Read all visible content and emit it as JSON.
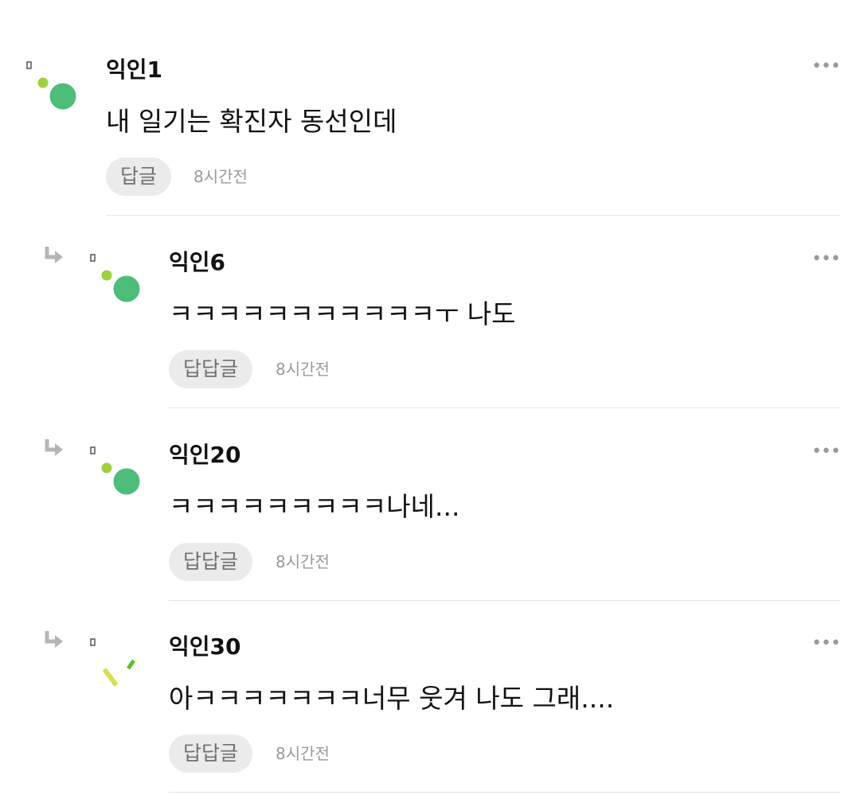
{
  "colors": {
    "avatar_green": "#4dbd7a",
    "avatar_lime": "#9cd23a",
    "avatar_yellow": "#d7df4d",
    "reply_button_bg": "#ebebeb",
    "meta_gray": "#9a9a9a"
  },
  "comments": [
    {
      "author": "익인1",
      "text": "내 일기는 확진자 동선인데",
      "reply_label": "답글",
      "time": "8시간전",
      "more_icon": "more-horizontal-icon"
    },
    {
      "author": "익인6",
      "text": "ㅋㅋㅋㅋㅋㅋㅋㅋㅋㅋㅋㅜ 나도",
      "reply_label": "답답글",
      "time": "8시간전",
      "more_icon": "more-horizontal-icon"
    },
    {
      "author": "익인20",
      "text": "ㅋㅋㅋㅋㅋㅋㅋㅋㅋ나네...",
      "reply_label": "답답글",
      "time": "8시간전",
      "more_icon": "more-horizontal-icon"
    },
    {
      "author": "익인30",
      "text": "아ㅋㅋㅋㅋㅋㅋㅋ너무 웃겨 나도 그래....",
      "reply_label": "답답글",
      "time": "8시간전",
      "more_icon": "more-horizontal-icon"
    }
  ]
}
